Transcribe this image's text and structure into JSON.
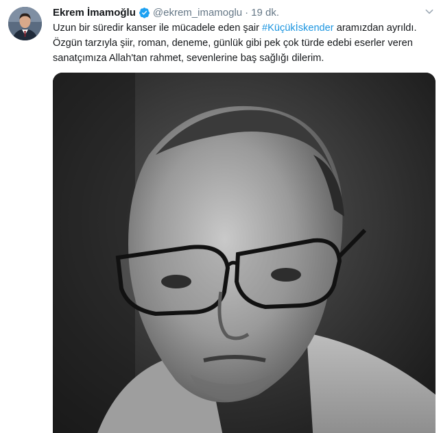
{
  "tweet": {
    "display_name": "Ekrem İmamoğlu",
    "handle": "@ekrem_imamoglu",
    "separator": "·",
    "time": "19 dk.",
    "text_before_hashtag": "Uzun bir süredir kanser ile mücadele eden şair ",
    "hashtag": "#Küçükİskender",
    "text_after_hashtag": " aramızdan ayrıldı.",
    "text_line2": "Özgün tarzıyla şiir, roman, deneme, günlük gibi pek çok türde edebi eserler veren",
    "text_line3": "sanatçımıza Allah'tan rahmet, sevenlerine baş sağlığı dilerim."
  },
  "icons": {
    "verified": "verified-badge-icon",
    "menu": "chevron-down-icon"
  },
  "colors": {
    "link": "#1b95e0",
    "verified": "#1da1f2",
    "secondary_text": "#657786",
    "primary_text": "#14171a"
  }
}
